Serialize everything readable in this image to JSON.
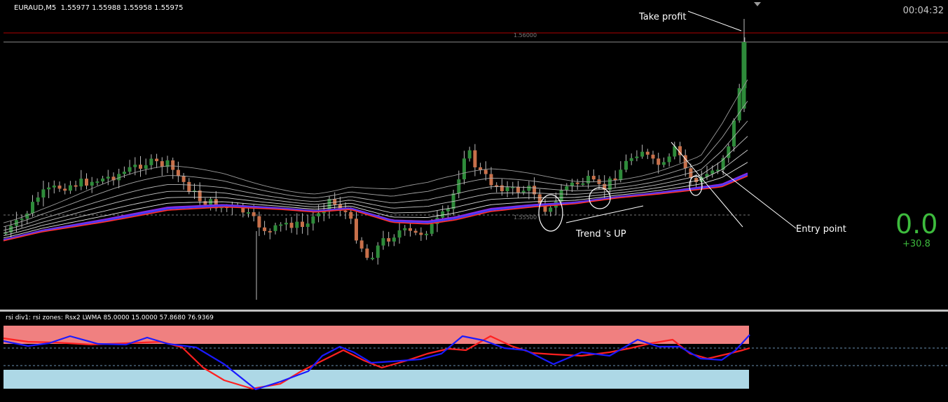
{
  "header": {
    "symbol": "EURAUD,M5",
    "ohlc": "1.55977 1.55988 1.55958 1.55975"
  },
  "timer": "00:04:32",
  "price_levels": {
    "top": "1.56000",
    "bottom": "1.55500"
  },
  "annotations": {
    "take_profit": "Take profit",
    "trend_up": "Trend 's UP",
    "entry_point": "Entry point"
  },
  "signal": {
    "value": "0.0",
    "pips": "+30.8"
  },
  "indicator": {
    "header": "rsi div1: rsi zones: Rsx2 LWMA 85.0000 15.0000 57.8680 76.9369"
  },
  "colors": {
    "bull_candle": "#2e8b3a",
    "bear_candle": "#c8704a",
    "ma_ribbon": "#cfcfcf",
    "ma_blue": "#3b3bff",
    "ma_red": "#ff3030",
    "ma_purple": "#8a2be2",
    "level_line": "#b00000",
    "rsi_upper_zone": "#f08080",
    "rsi_lower_zone": "#add8e6",
    "rsi_red": "#ff2020",
    "rsi_blue": "#1a1aff",
    "signal_green": "#3dbb3d"
  }
}
